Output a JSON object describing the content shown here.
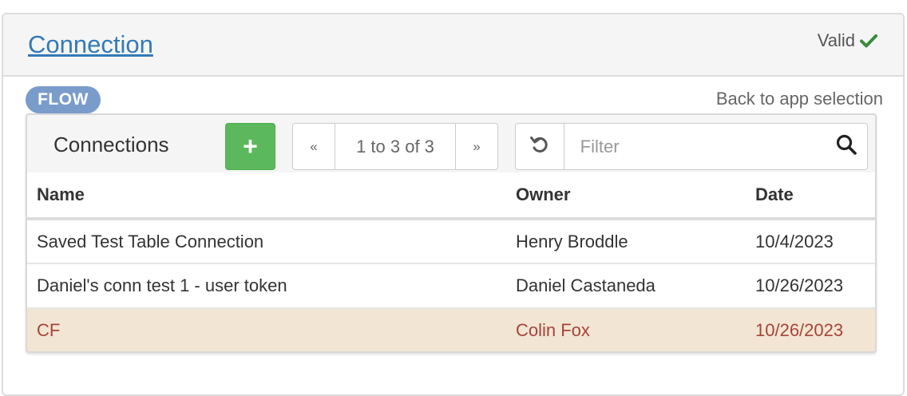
{
  "header": {
    "title": "Connection",
    "status_label": "Valid",
    "status_icon": "check-icon",
    "status_color": "#3c8b3c"
  },
  "badge": {
    "label": "FLOW",
    "color": "#7a9ccb"
  },
  "back_link": "Back to app selection",
  "toolbar": {
    "title": "Connections",
    "add_label": "+",
    "pager": {
      "prev": "«",
      "info": "1 to 3 of 3",
      "next": "»"
    },
    "filter_placeholder": "Filter",
    "refresh_icon": "refresh-icon",
    "search_icon": "search-icon"
  },
  "table": {
    "columns": [
      "Name",
      "Owner",
      "Date"
    ],
    "rows": [
      {
        "name": "Saved Test Table Connection",
        "owner": "Henry Broddle",
        "date": "10/4/2023",
        "selected": false
      },
      {
        "name": "Daniel's conn test 1 - user token",
        "owner": "Daniel Castaneda",
        "date": "10/26/2023",
        "selected": false
      },
      {
        "name": "CF",
        "owner": "Colin Fox",
        "date": "10/26/2023",
        "selected": true
      }
    ]
  },
  "colors": {
    "accent_link": "#337ab7",
    "add_button": "#5cb85c",
    "selected_row_bg": "#f3e5d3",
    "selected_row_text": "#a5453a"
  }
}
